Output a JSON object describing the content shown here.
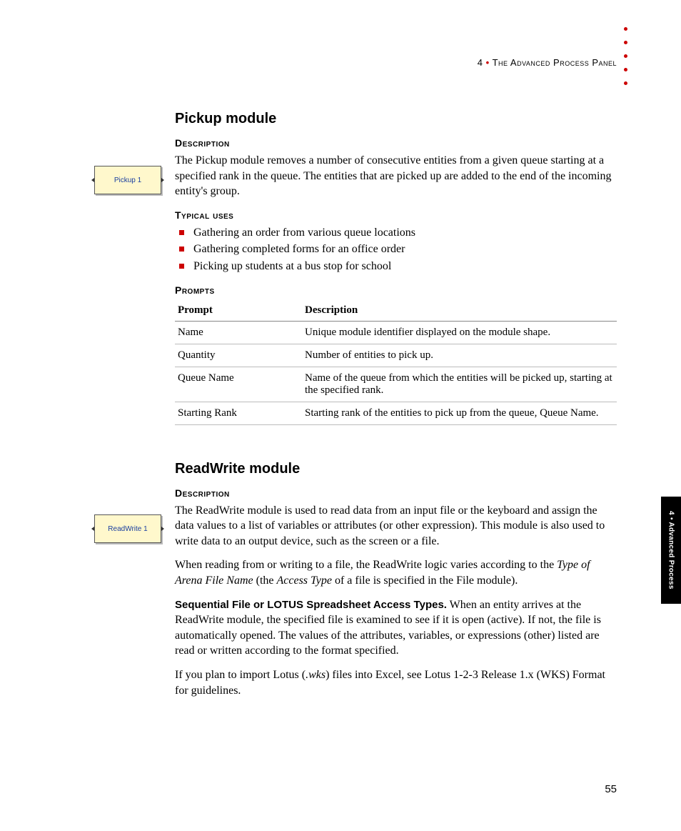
{
  "header": {
    "chapter_num": "4",
    "sep": "•",
    "chapter_title": "The Advanced Process Panel"
  },
  "module1": {
    "title": "Pickup module",
    "shape_label": "Pickup 1",
    "sub_desc": "Description",
    "desc_body": "The Pickup module removes a number of consecutive entities from a given queue starting at a specified rank in the queue. The entities that are picked up are added to the end of the incoming entity's group.",
    "sub_uses": "Typical uses",
    "uses": [
      "Gathering an order from various queue locations",
      "Gathering completed forms for an office order",
      "Picking up students at a bus stop for school"
    ],
    "sub_prompts": "Prompts",
    "table": {
      "h1": "Prompt",
      "h2": "Description",
      "rows": [
        {
          "p": "Name",
          "d": "Unique module identifier displayed on the module shape."
        },
        {
          "p": "Quantity",
          "d": "Number of entities to pick up."
        },
        {
          "p": "Queue Name",
          "d": "Name of the queue from which the entities will be picked up, starting at the specified rank."
        },
        {
          "p": "Starting Rank",
          "d": "Starting rank of the entities to pick up from the queue, Queue Name."
        }
      ]
    }
  },
  "module2": {
    "title": "ReadWrite module",
    "shape_label": "ReadWrite 1",
    "sub_desc": "Description",
    "p1": "The ReadWrite module is used to read data from an input file or the keyboard and assign the data values to a list of variables or attributes (or other expression). This module is also used to write data to an output device, such as the screen or a file.",
    "p2a": "When reading from or writing to a file, the ReadWrite logic varies according to the ",
    "p2b_i": "Type of Arena File Name",
    "p2c": " (the ",
    "p2d_i": "Access Type",
    "p2e": " of a file is specified in the File module).",
    "p3_bold": "Sequential File or LOTUS Spreadsheet Access Types.",
    "p3_rest": " When an entity arrives at the ReadWrite module, the specified file is examined to see if it is open (active). If not, the file is automatically opened. The values of the attributes, variables, or expressions (other) listed are read or written according to the format specified.",
    "p4a": "If you plan to import Lotus (",
    "p4b_i": ".wks",
    "p4c": ") files into Excel, see Lotus 1-2-3 Release 1.x (WKS) Format for guidelines."
  },
  "side_tab": "4 • Advanced Process",
  "page_number": "55"
}
